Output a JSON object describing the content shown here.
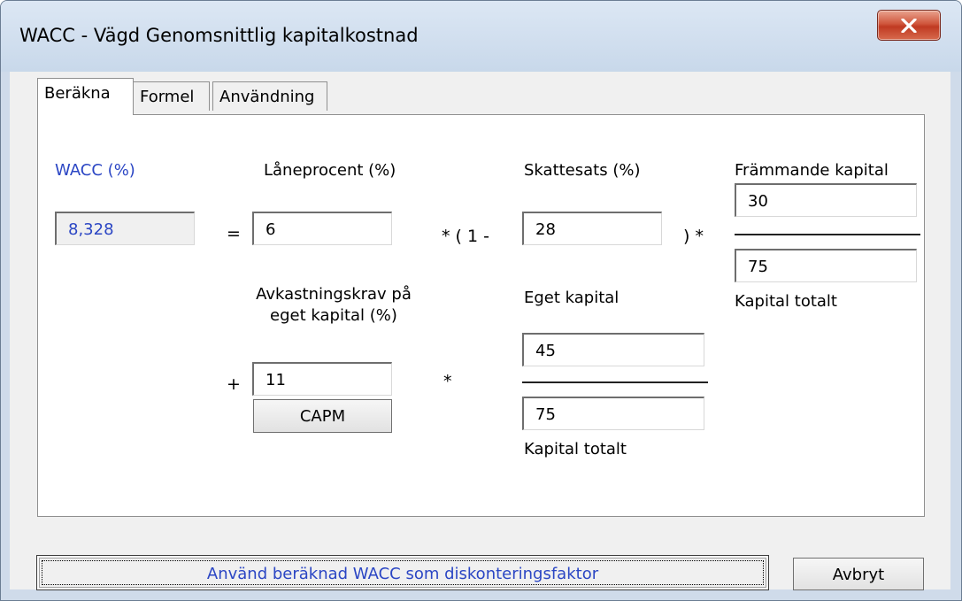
{
  "window": {
    "title": "WACC - Vägd Genomsnittlig kapitalkostnad"
  },
  "tabs": [
    {
      "label": "Beräkna",
      "active": true
    },
    {
      "label": "Formel",
      "active": false
    },
    {
      "label": "Användning",
      "active": false
    }
  ],
  "form": {
    "wacc": {
      "label": "WACC (%)",
      "value": "8,328"
    },
    "loan_rate": {
      "label": "Låneprocent (%)",
      "value": "6"
    },
    "tax_rate": {
      "label": "Skattesats (%)",
      "value": "28"
    },
    "debt": {
      "label": "Främmande kapital",
      "value": "30"
    },
    "total_capital_1": {
      "label": "Kapital totalt",
      "value": "75"
    },
    "equity_return": {
      "label_line1": "Avkastningskrav på",
      "label_line2": "eget kapital (%)",
      "value": "11"
    },
    "equity": {
      "label": "Eget kapital",
      "value": "45"
    },
    "total_capital_2": {
      "label": "Kapital totalt",
      "value": "75"
    },
    "capm_button": "CAPM"
  },
  "operators": {
    "equals": "=",
    "times_one_minus": "* ( 1 -",
    "close_times": ") *",
    "plus": "+",
    "times": "*"
  },
  "footer": {
    "apply_button": "Använd beräknad WACC som diskonteringsfaktor",
    "cancel_button": "Avbryt"
  },
  "colors": {
    "accent_blue": "#2b46c4",
    "close_red": "#c8472c"
  }
}
